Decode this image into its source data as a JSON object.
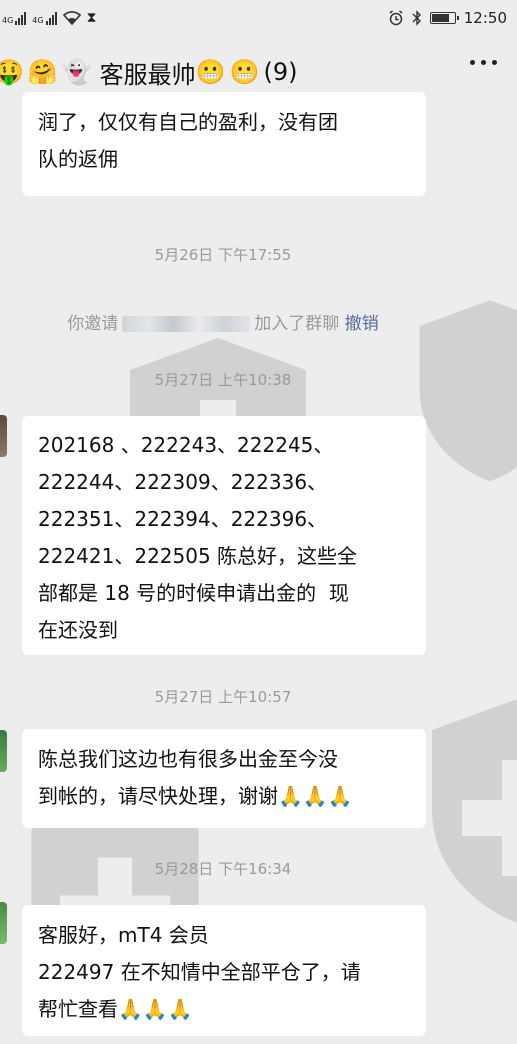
{
  "status_bar": {
    "network_left": "4G",
    "network_right": "4G",
    "time": "12:50"
  },
  "header": {
    "emojis": [
      "🤑",
      "🤗",
      "👻"
    ],
    "title": "客服最帅",
    "title_emojis": [
      "😬",
      "😬"
    ],
    "member_count": "(9)"
  },
  "messages": [
    {
      "type": "bubble",
      "text": "润了，仅仅有自己的盈利，没有团\n队的返佣"
    },
    {
      "type": "timestamp",
      "text": "5月26日 下午17:55"
    },
    {
      "type": "system",
      "prefix": "你邀请",
      "suffix": "加入了群聊",
      "action": "撤销"
    },
    {
      "type": "timestamp",
      "text": "5月27日 上午10:38"
    },
    {
      "type": "bubble",
      "text": "202168 、222243、222245、\n222244、222309、222336、\n222351、222394、222396、\n222421、222505 陈总好，这些全\n部都是 18 号的时候申请出金的  现\n在还没到"
    },
    {
      "type": "timestamp",
      "text": "5月27日 上午10:57"
    },
    {
      "type": "bubble",
      "text": "陈总我们这边也有很多出金至今没\n到帐的，请尽快处理，谢谢🙏🙏🙏"
    },
    {
      "type": "timestamp",
      "text": "5月28日 下午16:34"
    },
    {
      "type": "bubble",
      "text": "客服好，mT4 会员\n222497 在不知情中全部平仓了，请\n帮忙查看🙏🙏🙏"
    }
  ],
  "colors": {
    "background": "#ededed",
    "bubble": "#ffffff",
    "timestamp": "#9a9a9a",
    "link": "#576b95"
  }
}
